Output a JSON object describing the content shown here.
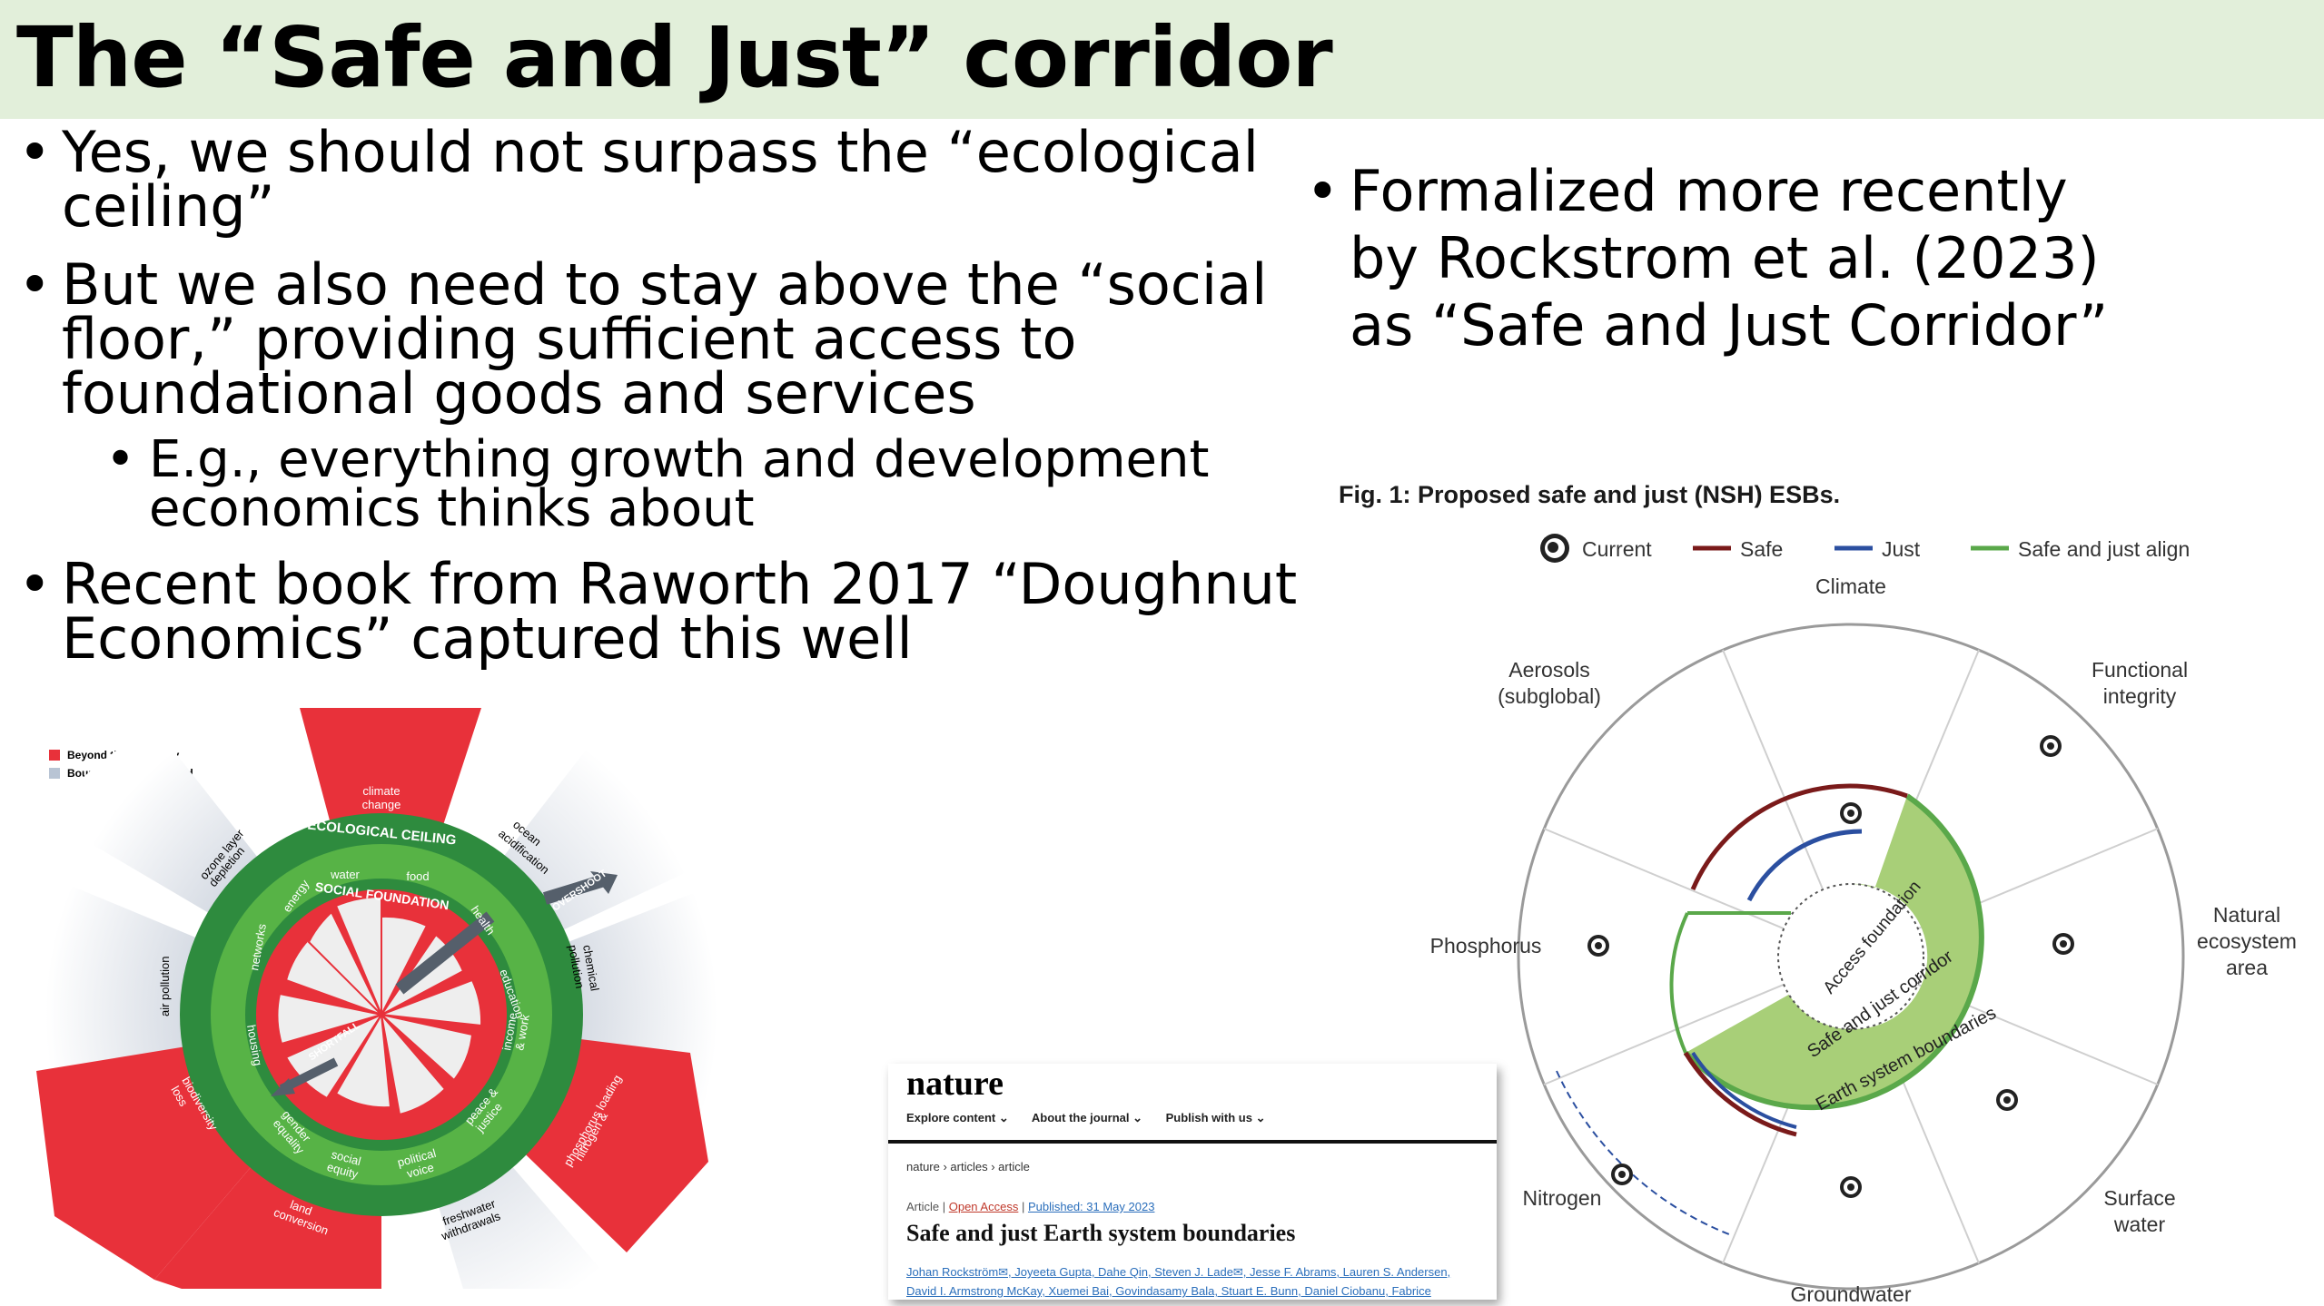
{
  "slide": {
    "title": "The “Safe and Just” corridor",
    "bullets": [
      {
        "line1": "Yes, we should not surpass the “ecological",
        "line2": "ceiling”"
      },
      {
        "line1": "But we also need to stay above the “social",
        "line2": "floor,” providing sufficient access to",
        "line3": "foundational goods and services"
      },
      {
        "line1": "Recent book from Raworth 2017 “Doughnut",
        "line2": "Economics” captured this well"
      }
    ],
    "sub_bullet": {
      "line1": "E.g., everything growth and development",
      "line2": "economics thinks about"
    },
    "right_bullet": {
      "line1": "Formalized more recently",
      "line2": "by Rockstrom et al. (2023)",
      "line3": "as “Safe and Just Corridor”"
    }
  },
  "doughnut": {
    "legend": [
      "Beyond the boundary",
      "Boundary not quantified"
    ],
    "colors": {
      "beyond": "#e8313a",
      "not_quantified": "#b8c4d4",
      "ring_dark": "#2e8b3e",
      "ring_light": "#57b346"
    },
    "ceiling_label": "ECOLOGICAL CEILING",
    "foundation_label": "SOCIAL FOUNDATION",
    "overshoot_label": "OVERSHOOT",
    "shortfall_label": "SHORTFALL",
    "outer_labels": {
      "climate": [
        "climate",
        "change"
      ],
      "ocean": [
        "ocean",
        "acidification"
      ],
      "chemical": [
        "chemical",
        "pollution"
      ],
      "nitrogen": [
        "nitrogen &",
        "phosphorus loading"
      ],
      "freshwater": [
        "freshwater",
        "withdrawals"
      ],
      "land": [
        "land",
        "conversion"
      ],
      "biodiversity": [
        "biodiversity",
        "loss"
      ],
      "air": "air pollution",
      "ozone": [
        "ozone layer",
        "depletion"
      ]
    },
    "inner_labels": {
      "water": "water",
      "food": "food",
      "health": "health",
      "education": "education",
      "income": [
        "income",
        "& work"
      ],
      "peace": [
        "peace &",
        "justice"
      ],
      "political": [
        "political",
        "voice"
      ],
      "social_equity": [
        "social",
        "equity"
      ],
      "gender": [
        "gender",
        "equality"
      ],
      "housing": "housing",
      "networks": "networks",
      "energy": "energy"
    }
  },
  "figure": {
    "caption": "Fig. 1: Proposed safe and just (NSH) ESBs.",
    "legend": {
      "current": "Current",
      "safe": "Safe",
      "just": "Just",
      "align": "Safe and just align"
    },
    "colors": {
      "safe": "#7a1a1a",
      "just": "#2b4fa0",
      "align": "#a8cf78",
      "align_stroke": "#5aa84a"
    },
    "sectors": {
      "climate": "Climate",
      "functional": [
        "Functional",
        "integrity"
      ],
      "natural": [
        "Natural",
        "ecosystem",
        "area"
      ],
      "surface": [
        "Surface",
        "water"
      ],
      "groundwater": "Groundwater",
      "nitrogen": "Nitrogen",
      "phosphorus": "Phosphorus",
      "aerosols": [
        "Aerosols",
        "(subglobal)"
      ]
    },
    "ring_labels": {
      "access": "Access foundation",
      "corridor": "Safe and just corridor",
      "earth": "Earth system boundaries"
    }
  },
  "article": {
    "brand": "nature",
    "nav": [
      "Explore content ⌄",
      "About the journal ⌄",
      "Publish with us ⌄"
    ],
    "breadcrumb": "nature  ›  articles  ›  article",
    "type": "Article",
    "access": "Open Access",
    "published": "Published: 31 May 2023",
    "title": "Safe and just Earth system boundaries",
    "authors": "Johan Rockström✉, Joyeeta Gupta, Dahe Qin, Steven J. Lade✉, Jesse F. Abrams, Lauren S. Andersen,",
    "authors2": "David I. Armstrong McKay, Xuemei Bai, Govindasamy Bala, Stuart E. Bunn, Daniel Ciobanu, Fabrice"
  }
}
